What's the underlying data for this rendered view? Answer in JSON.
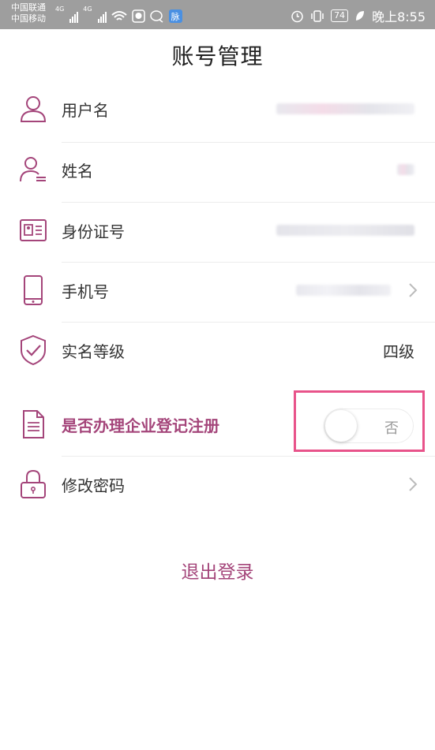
{
  "status_bar": {
    "carrier_1": "中国联通",
    "carrier_2": "中国移动",
    "network_1": "4G",
    "network_2": "4G",
    "app_badge": "脉",
    "battery": "74",
    "time": "晚上8:55"
  },
  "page": {
    "title": "账号管理"
  },
  "rows": {
    "username": {
      "label": "用户名",
      "icon": "person-icon"
    },
    "name": {
      "label": "姓名",
      "icon": "person-list-icon"
    },
    "id_number": {
      "label": "身份证号",
      "icon": "id-card-icon"
    },
    "phone": {
      "label": "手机号",
      "icon": "phone-icon"
    },
    "realname_level": {
      "label": "实名等级",
      "value": "四级",
      "icon": "shield-check-icon"
    },
    "enterprise_registration": {
      "label": "是否办理企业登记注册",
      "toggle_text": "否",
      "toggle_on": false,
      "icon": "document-icon"
    },
    "change_password": {
      "label": "修改密码",
      "icon": "lock-icon"
    }
  },
  "logout_label": "退出登录",
  "colors": {
    "accent": "#a4457a",
    "highlight": "#e8538a",
    "status_bar_bg": "#9e9e9e"
  }
}
